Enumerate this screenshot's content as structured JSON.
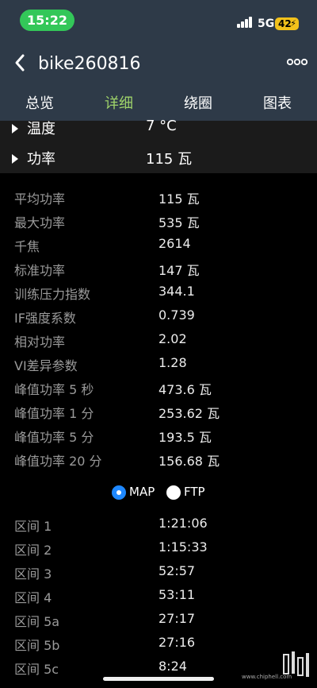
{
  "status": {
    "time": "15:22",
    "network": "5G",
    "battery": "42"
  },
  "nav": {
    "title": "bike260816"
  },
  "tabs": [
    {
      "label": "总览",
      "active": false
    },
    {
      "label": "详细",
      "active": true
    },
    {
      "label": "绕圈",
      "active": false
    },
    {
      "label": "图表",
      "active": false
    }
  ],
  "colors": {
    "active_tab": "#9fd36a",
    "inactive_tab": "#ffffff",
    "header_bg": "#2e3a48",
    "radio_on": "#1e88ff"
  },
  "summary": [
    {
      "label": "温度",
      "value": "7 °C"
    },
    {
      "label": "功率",
      "value": "115 瓦"
    }
  ],
  "metrics": [
    {
      "label": "平均功率",
      "value": "115 瓦"
    },
    {
      "label": "最大功率",
      "value": "535 瓦"
    },
    {
      "label": "千焦",
      "value": "2614"
    },
    {
      "label": "标准功率",
      "value": "147 瓦"
    },
    {
      "label": "训练压力指数",
      "value": "344.1"
    },
    {
      "label": "IF强度系数",
      "value": "0.739"
    },
    {
      "label": "相对功率",
      "value": "2.02"
    },
    {
      "label": "VI差异参数",
      "value": "1.28"
    },
    {
      "label": "峰值功率 5 秒",
      "value": "473.6 瓦"
    },
    {
      "label": "峰值功率 1 分",
      "value": "253.62 瓦"
    },
    {
      "label": "峰值功率 5 分",
      "value": "193.5 瓦"
    },
    {
      "label": "峰值功率 20 分",
      "value": "156.68 瓦"
    }
  ],
  "zone_mode": {
    "options": [
      {
        "label": "MAP",
        "selected": true
      },
      {
        "label": "FTP",
        "selected": false
      }
    ]
  },
  "zones": [
    {
      "label": "区间 1",
      "value": "1:21:06"
    },
    {
      "label": "区间 2",
      "value": "1:15:33"
    },
    {
      "label": "区间 3",
      "value": "52:57"
    },
    {
      "label": "区间 4",
      "value": "53:11"
    },
    {
      "label": "区间 5a",
      "value": "27:17"
    },
    {
      "label": "区间 5b",
      "value": "27:16"
    },
    {
      "label": "区间 5c",
      "value": "8:24"
    }
  ],
  "watermark": {
    "text": "www.chiphell.com"
  }
}
